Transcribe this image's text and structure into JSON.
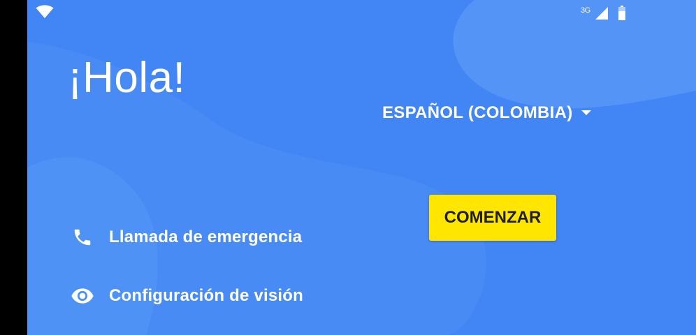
{
  "status_bar": {
    "network_type": "3G",
    "icons": [
      "wifi-icon",
      "cellular-signal-icon",
      "battery-icon"
    ]
  },
  "welcome": {
    "greeting": "¡Hola!",
    "language": "ESPAÑOL (COLOMBIA)",
    "start_button": "COMENZAR",
    "emergency_call": "Llamada de emergencia",
    "vision_settings": "Configuración de visión"
  },
  "colors": {
    "background": "#4285f4",
    "button": "#ffe600",
    "text": "#ffffff"
  }
}
